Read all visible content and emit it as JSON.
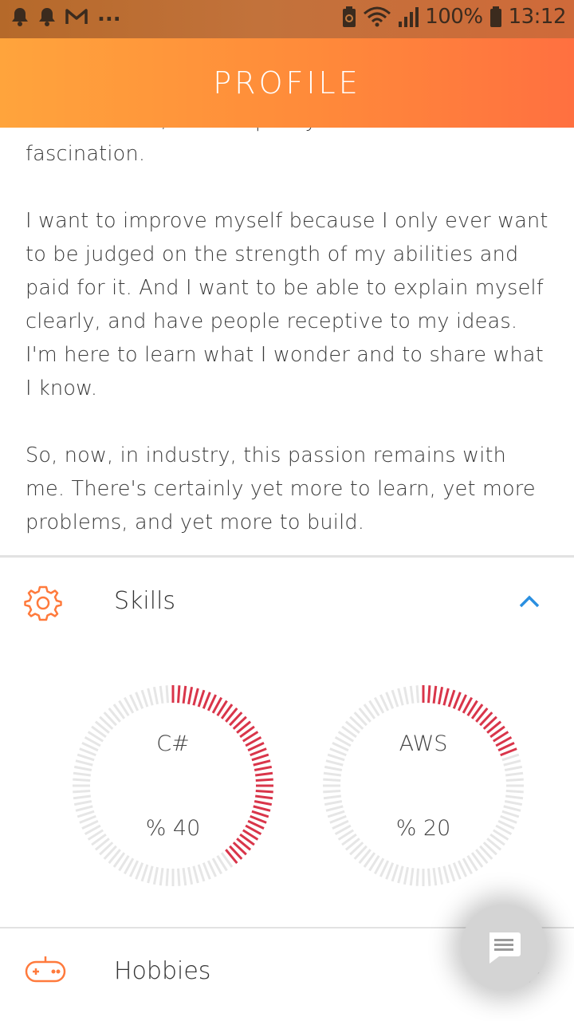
{
  "status_bar": {
    "battery_text": "100%",
    "time": "13:12",
    "more_indicator": "..."
  },
  "header": {
    "title": "PROFILE"
  },
  "about": {
    "partial_line": "mathematics, all with pretty much the same",
    "paragraphs": [
      "fascination.",
      "I want to improve myself because I only ever want to be judged on the strength of my abilities and paid for it. And I want to be able to explain myself clearly, and have people receptive to my ideas. I'm here to learn what I wonder and to share what I know.",
      "So, now, in industry, this passion remains with me. There's certainly yet more to learn, yet more problems, and yet more to build."
    ]
  },
  "skills": {
    "label": "Skills",
    "icon": "gear-icon",
    "expanded": true,
    "items": [
      {
        "name": "C#",
        "percent_text": "% 40",
        "percent": 40
      },
      {
        "name": "AWS",
        "percent_text": "% 20",
        "percent": 20
      }
    ]
  },
  "hobbies": {
    "label": "Hobbies",
    "icon": "gamepad-icon",
    "expanded": false
  },
  "colors": {
    "accent": "#ff7a3c",
    "gauge_fill": "#d9354a",
    "gauge_track": "#e6e6e6",
    "chevron_up": "#2a8fe0"
  }
}
